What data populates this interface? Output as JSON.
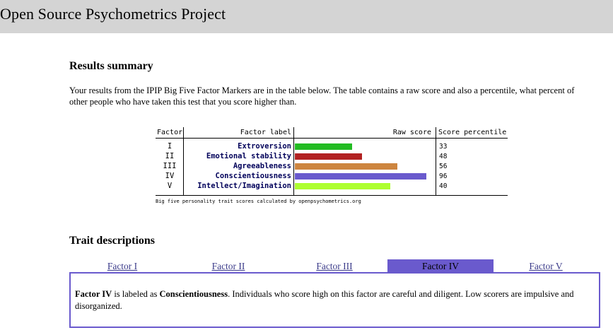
{
  "header": {
    "title": "Open Source Psychometrics Project"
  },
  "results": {
    "heading": "Results summary",
    "intro": "Your results from the IPIP Big Five Factor Markers are in the table below. The table contains a raw score and also a percentile, what percent of other people who have taken this test that you score higher than.",
    "columns": {
      "factor": "Factor",
      "label": "Factor label",
      "raw": "Raw score",
      "percentile": "Score percentile"
    },
    "rows": [
      {
        "roman": "I",
        "label": "Extroversion",
        "percentile": "33",
        "raw_fraction": 0.41,
        "color": "#22bb22"
      },
      {
        "roman": "II",
        "label": "Emotional stability",
        "percentile": "48",
        "raw_fraction": 0.48,
        "color": "#b22222"
      },
      {
        "roman": "III",
        "label": "Agreeableness",
        "percentile": "56",
        "raw_fraction": 0.73,
        "color": "#cd853f"
      },
      {
        "roman": "IV",
        "label": "Conscientiousness",
        "percentile": "96",
        "raw_fraction": 0.94,
        "color": "#6a5acd"
      },
      {
        "roman": "V",
        "label": "Intellect/Imagination",
        "percentile": "40",
        "raw_fraction": 0.68,
        "color": "#adff2f"
      }
    ],
    "footnote": "Big five personality trait scores calculated by openpsychometrics.org"
  },
  "traits": {
    "heading": "Trait descriptions",
    "tabs": [
      "Factor I",
      "Factor II",
      "Factor III",
      "Factor IV",
      "Factor V"
    ],
    "active_tab": "Factor IV",
    "description": {
      "factor": "Factor IV",
      "text1": " is labeled as ",
      "trait": "Conscientiousness",
      "text2": ". Individuals who score high on this factor are careful and diligent. Low scorers are impulsive and disorganized."
    }
  }
}
